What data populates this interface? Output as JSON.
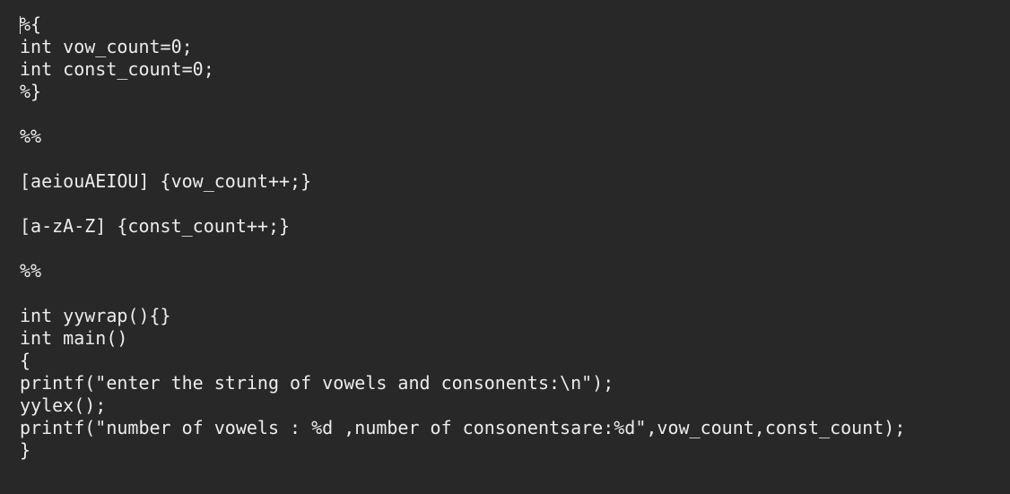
{
  "editor": {
    "lines": [
      "%{",
      "int vow_count=0;",
      "int const_count=0;",
      "%}",
      "",
      "%%",
      "",
      "[aeiouAEIOU] {vow_count++;}",
      "",
      "[a-zA-Z] {const_count++;}",
      "",
      "%%",
      "",
      "int yywrap(){}",
      "int main()",
      "{",
      "printf(\"enter the string of vowels and consonents:\\n\");",
      "yylex();",
      "printf(\"number of vowels : %d ,number of consonentsare:%d\",vow_count,const_count);",
      "}"
    ]
  }
}
